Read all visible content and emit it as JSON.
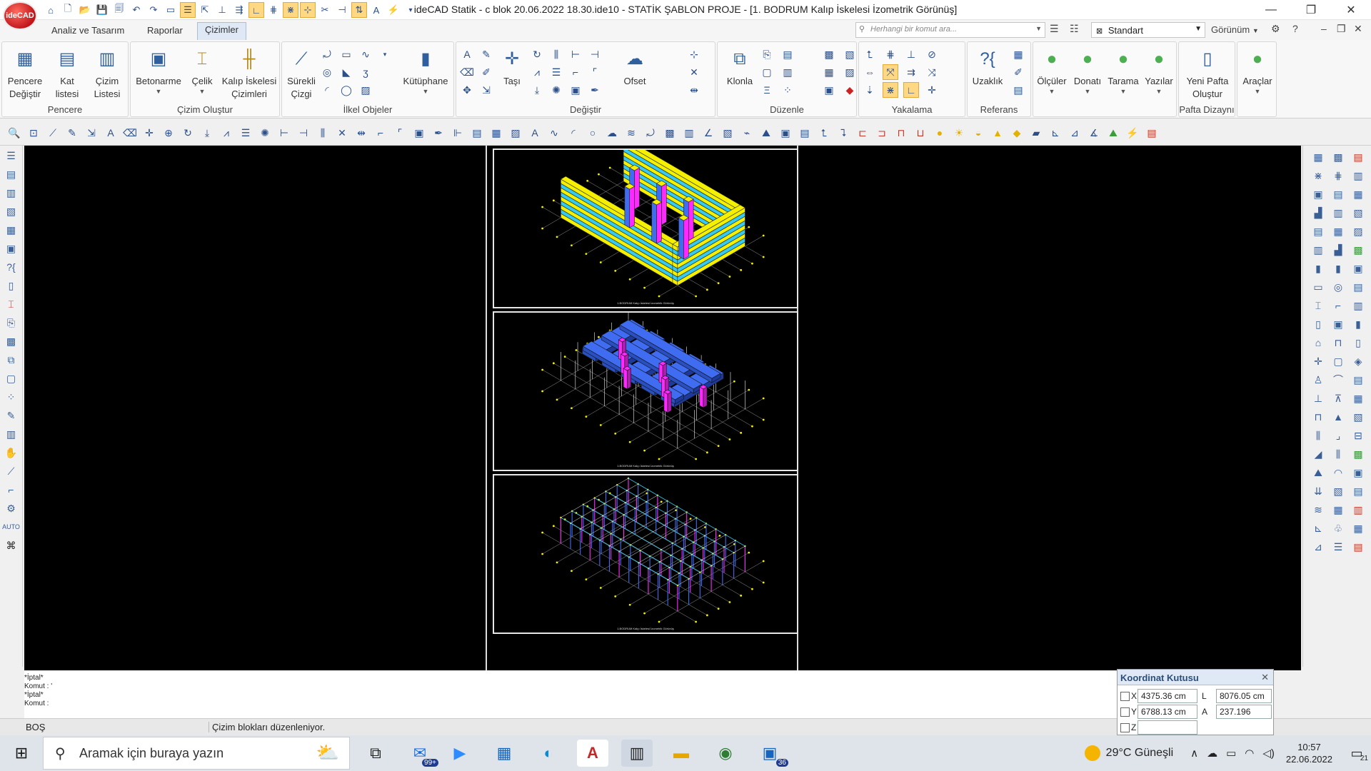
{
  "app": {
    "logo_text": "ideCAD",
    "window_title": "ideCAD Statik - c blok 20.06.2022 18.30.ide10 - STATİK ŞABLON PROJE - [1. BODRUM Kalıp İskelesi İzometrik Görünüş]"
  },
  "tabs": [
    "Analiz ve Tasarım",
    "Raporlar",
    "Çizimler"
  ],
  "active_tab": "Çizimler",
  "command_search": {
    "placeholder": "Herhangi bir komut ara..."
  },
  "style_selector": {
    "value": "Standart"
  },
  "view_menu": "Görünüm",
  "ribbon": {
    "pencere": {
      "label": "Pencere",
      "buttons": [
        {
          "label": "Pencere\nDeğiştir",
          "icon": "window-switch-icon"
        },
        {
          "label": "Kat\nlistesi",
          "icon": "floor-list-icon"
        },
        {
          "label": "Çizim\nListesi",
          "icon": "drawing-list-icon"
        }
      ]
    },
    "cizim_olustur": {
      "label": "Çizim Oluştur",
      "buttons": [
        {
          "label": "Betonarme",
          "icon": "concrete-icon"
        },
        {
          "label": "Çelik",
          "icon": "steel-icon"
        },
        {
          "label": "Kalıp İskelesi\nÇizimleri",
          "icon": "scaffold-icon"
        }
      ]
    },
    "ilkel_objeler": {
      "label": "İlkel Objeler",
      "buttons": [
        {
          "label": "Sürekli\nÇizgi",
          "icon": "polyline-icon"
        },
        {
          "label": "Kütüphane",
          "icon": "library-icon"
        }
      ]
    },
    "degistir": {
      "label": "Değiştir",
      "buttons": [
        {
          "label": "Taşı",
          "icon": "move-icon"
        },
        {
          "label": "Ofset",
          "icon": "offset-icon"
        }
      ]
    },
    "duzenle": {
      "label": "Düzenle",
      "buttons": [
        {
          "label": "Klonla",
          "icon": "clone-icon"
        }
      ]
    },
    "yakalama": {
      "label": "Yakalama"
    },
    "referans": {
      "label": "Referans",
      "buttons": [
        {
          "label": "Uzaklık",
          "icon": "distance-icon"
        }
      ]
    },
    "tools": [
      {
        "label": "Ölçüler",
        "icon": "dimensions-icon"
      },
      {
        "label": "Donatı",
        "icon": "rebar-icon"
      },
      {
        "label": "Tarama",
        "icon": "hatch-icon"
      },
      {
        "label": "Yazılar",
        "icon": "text-icon"
      }
    ],
    "pafta": {
      "label": "Pafta Dizaynı",
      "buttons": [
        {
          "label": "Yeni Pafta\nOluştur",
          "icon": "new-sheet-icon"
        }
      ]
    },
    "araclar": {
      "label": "Araçlar",
      "icon": "tools-icon"
    }
  },
  "drawing": {
    "panels": [
      {
        "caption": "1.BODRUM Kalıp İskelesi İzometrik Görünüş"
      },
      {
        "caption": "1.BODRUM Kalıp İskelesi İzometrik Görünüş"
      },
      {
        "caption": "1.BODRUM Kalıp İskelesi İzometrik Görünüş"
      }
    ],
    "colors": {
      "background": "#000000",
      "yellow": "#f4f000",
      "cyan": "#35c8f0",
      "blue": "#3f6cf0",
      "magenta": "#ff28ff",
      "white": "#f0f0f0"
    }
  },
  "command_line": {
    "lines": [
      "*İptal*",
      "Komut : '",
      "*İptal*",
      "Komut :"
    ]
  },
  "status_bar": {
    "mode": "BOŞ",
    "message": "Çizim blokları düzenleniyor."
  },
  "coord_box": {
    "title": "Koordinat Kutusu",
    "x_label": "X",
    "x_value": "4375.36 cm",
    "y_label": "Y",
    "y_value": "6788.13 cm",
    "z_label": "Z",
    "z_value": "",
    "l_label": "L",
    "l_value": "8076.05 cm",
    "a_label": "A",
    "a_value": "237.196"
  },
  "taskbar": {
    "search_placeholder": "Aramak için buraya yazın",
    "mail_badge": "99+",
    "app_badge": "36",
    "weather": "29°C  Güneşli",
    "time": "10:57",
    "date": "22.06.2022",
    "notifications": "21"
  }
}
